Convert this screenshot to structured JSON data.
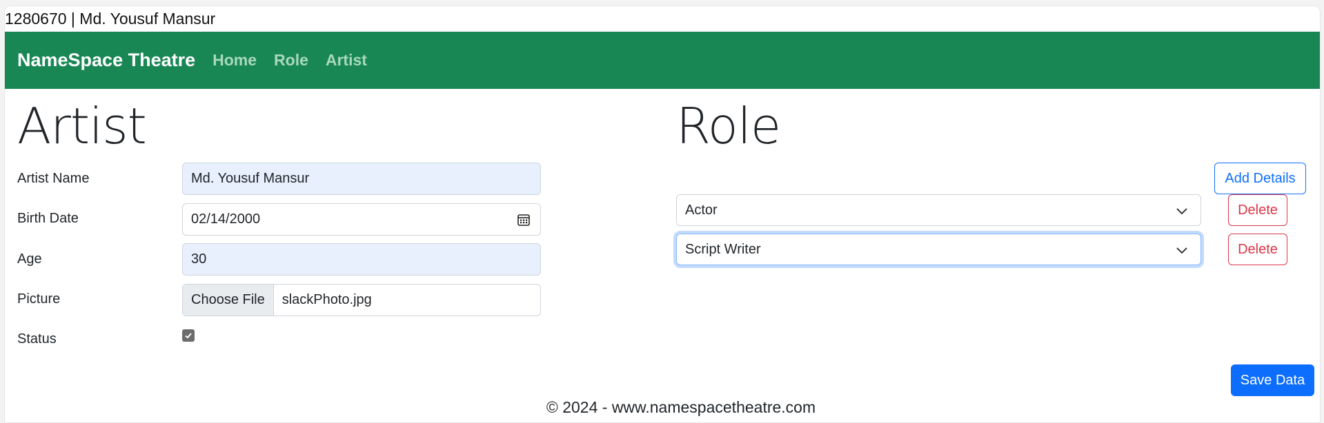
{
  "header": {
    "title": "1280670 | Md. Yousuf Mansur"
  },
  "navbar": {
    "brand": "NameSpace Theatre",
    "links": [
      "Home",
      "Role",
      "Artist"
    ],
    "bg_color": "#198754"
  },
  "artist": {
    "heading": "Artist",
    "fields": {
      "name": {
        "label": "Artist Name",
        "value": "Md. Yousuf Mansur"
      },
      "birth_date": {
        "label": "Birth Date",
        "value": "02/14/2000"
      },
      "age": {
        "label": "Age",
        "value": "30"
      },
      "picture": {
        "label": "Picture",
        "button": "Choose File",
        "file": "slackPhoto.jpg"
      },
      "status": {
        "label": "Status",
        "checked": true
      }
    }
  },
  "role": {
    "heading": "Role",
    "add_button": "Add Details",
    "rows": [
      {
        "value": "Actor",
        "delete_label": "Delete"
      },
      {
        "value": "Script Writer",
        "delete_label": "Delete"
      }
    ]
  },
  "actions": {
    "save_label": "Save Data"
  },
  "footer": {
    "text": "© 2024 - www.namespacetheatre.com"
  }
}
